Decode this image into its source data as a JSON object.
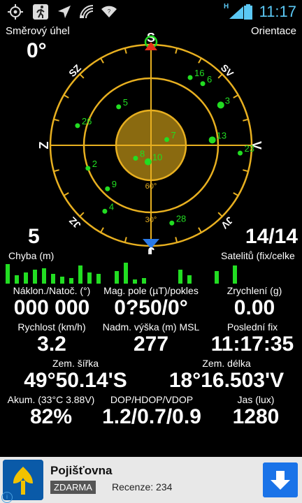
{
  "status": {
    "time": "11:17",
    "network": "H"
  },
  "header": {
    "left_label": "Směrový úhel",
    "right_label": "Orientace",
    "angle": "0°"
  },
  "radar": {
    "directions": {
      "n": "S",
      "s": "J",
      "e": "V",
      "w": "Z",
      "nw": "SZ",
      "ne": "SV",
      "sw": "JZ",
      "se": "JV"
    },
    "ring_labels": {
      "inner": "60°",
      "mid": "30°"
    },
    "satellites": [
      {
        "id": "16",
        "az": 30,
        "el": 20
      },
      {
        "id": "6",
        "az": 40,
        "el": 18
      },
      {
        "id": "3",
        "az": 60,
        "el": 18
      },
      {
        "id": "13",
        "az": 85,
        "el": 35
      },
      {
        "id": "23",
        "az": 95,
        "el": 10
      },
      {
        "id": "5",
        "az": 320,
        "el": 45
      },
      {
        "id": "26",
        "az": 285,
        "el": 22
      },
      {
        "id": "7",
        "az": 70,
        "el": 75
      },
      {
        "id": "8",
        "az": 230,
        "el": 72
      },
      {
        "id": "10",
        "az": 190,
        "el": 75
      },
      {
        "id": "2",
        "az": 250,
        "el": 30
      },
      {
        "id": "9",
        "az": 225,
        "el": 35
      },
      {
        "id": "4",
        "az": 215,
        "el": 18
      },
      {
        "id": "28",
        "az": 165,
        "el": 18
      }
    ]
  },
  "counts": {
    "left": "5",
    "right": "14/14",
    "left_label": "Chyba (m)",
    "right_label": "Satelitů (fix/celke"
  },
  "snr_bars": [
    28,
    12,
    16,
    20,
    22,
    14,
    10,
    8,
    26,
    16,
    14,
    0,
    18,
    30,
    6,
    8,
    0,
    0,
    0,
    20,
    12,
    0,
    0,
    18,
    0,
    26
  ],
  "metrics": {
    "tilt": {
      "label": "Náklon./Natoč. (°)",
      "value": "000 000"
    },
    "mag": {
      "label": "Mag. pole (µT)/pokles",
      "value": "0?50/0°"
    },
    "accel": {
      "label": "Zrychlení (g)",
      "value": "0.00"
    },
    "speed": {
      "label": "Rychlost (km/h)",
      "value": "3.2"
    },
    "alt": {
      "label": "Nadm. výška (m) MSL",
      "value": "277"
    },
    "lastfix": {
      "label": "Poslední fix",
      "value": "11:17:35"
    },
    "lat": {
      "label": "Zem. šířka",
      "value": "49°50.14'S"
    },
    "lon": {
      "label": "Zem. délka",
      "value": "18°16.503'V"
    },
    "battery": {
      "label": "Akum. (33°C 3.88V)",
      "value": "82%"
    },
    "dop": {
      "label": "DOP/HDOP/VDOP",
      "value": "1.2/0.7/0.9"
    },
    "lux": {
      "label": "Jas (lux)",
      "value": "1280"
    }
  },
  "ad": {
    "title": "Pojišťovna",
    "badge": "ZDARMA",
    "reviews": "Recenze: 234"
  },
  "colors": {
    "ring": "#e8b020",
    "sat": "#22dd22",
    "clock": "#5bc8f5",
    "fill": "#8a6a10"
  }
}
